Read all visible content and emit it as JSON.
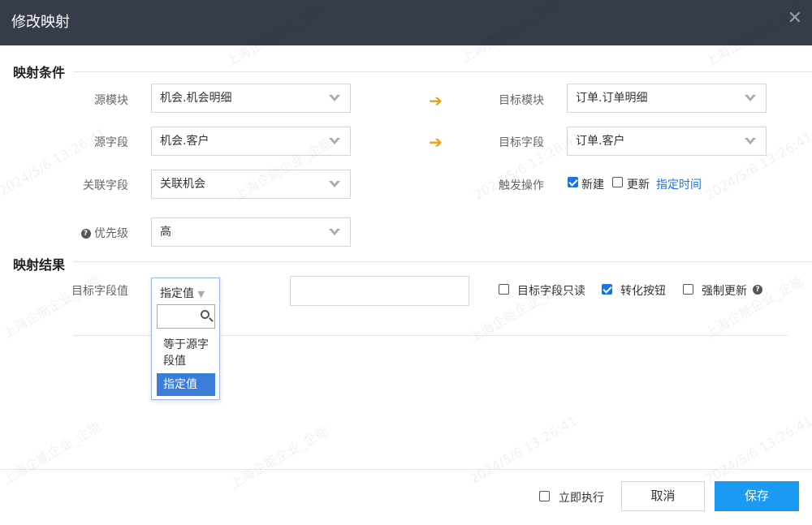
{
  "dialog": {
    "title": "修改映射",
    "close_glyph": "✕"
  },
  "condition_section": {
    "title": "映射条件",
    "source_module": {
      "label": "源模块",
      "value": "机会.机会明细"
    },
    "source_field": {
      "label": "源字段",
      "value": "机会.客户"
    },
    "relation_field": {
      "label": "关联字段",
      "value": "关联机会"
    },
    "priority": {
      "label": "优先级",
      "value": "高"
    },
    "target_module": {
      "label": "目标模块",
      "value": "订单.订单明细"
    },
    "target_field": {
      "label": "目标字段",
      "value": "订单.客户"
    },
    "trigger": {
      "label": "触发操作",
      "create": {
        "label": "新建",
        "checked": true
      },
      "update": {
        "label": "更新",
        "checked": false
      },
      "schedule_link": "指定时间"
    },
    "arrow_glyph": "➔",
    "arrow_color": "#f39c12"
  },
  "result_section": {
    "title": "映射结果",
    "target_value_label": "目标字段值",
    "target_value_select": "指定值",
    "value_input": "",
    "readonly": {
      "label": "目标字段只读",
      "checked": false
    },
    "convert_button": {
      "label": "转化按钮",
      "checked": true
    },
    "force_update": {
      "label": "强制更新",
      "checked": false
    },
    "dropdown": {
      "search_placeholder": "",
      "options": [
        {
          "label": "等于源字段值",
          "selected": false
        },
        {
          "label": "指定值",
          "selected": true
        }
      ]
    }
  },
  "footer": {
    "execute_now": {
      "label": "立即执行",
      "checked": false
    },
    "cancel_label": "取消",
    "save_label": "保存"
  },
  "watermarks": [
    "上海企能企业_企能",
    "2024/5/6 13:26:41"
  ],
  "colors": {
    "header_bg": "#363c4a",
    "accent": "#1a73e8",
    "save_bg": "#1a9af2",
    "selected_option_bg": "#3b7dd8"
  }
}
